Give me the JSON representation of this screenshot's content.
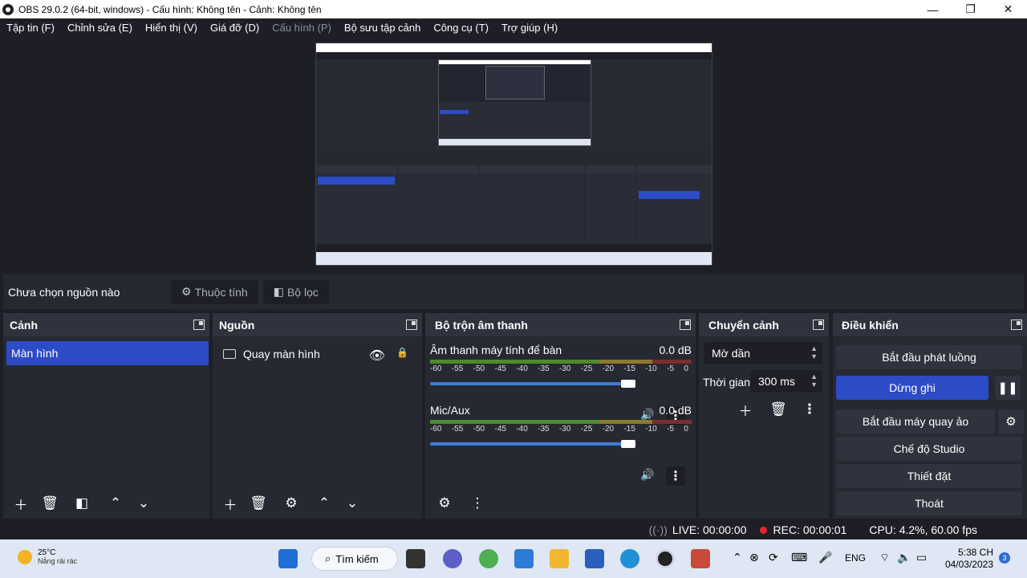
{
  "window": {
    "title": "OBS 29.0.2 (64-bit, windows) - Cấu hình: Không tên - Cảnh: Không tên",
    "minimize": "—",
    "maximize": "❐",
    "close": "✕"
  },
  "menu": {
    "file": "Tập tin (F)",
    "edit": "Chỉnh sửa (E)",
    "view": "Hiển thị (V)",
    "docks": "Giá đỡ (D)",
    "profile": "Cấu hình (P)",
    "scene_collection": "Bộ sưu tập cảnh",
    "tools": "Công cụ (T)",
    "help": "Trợ giúp (H)"
  },
  "source_toolbar": {
    "no_source": "Chưa chọn nguồn nào",
    "properties": "Thuộc tính",
    "filters": "Bộ lọc"
  },
  "scenes": {
    "title": "Cảnh",
    "items": [
      "Màn hình"
    ]
  },
  "sources": {
    "title": "Nguồn",
    "items": [
      "Quay màn hình"
    ]
  },
  "mixer": {
    "title": "Bộ trộn âm thanh",
    "ticks": [
      "-60",
      "-55",
      "-50",
      "-45",
      "-40",
      "-35",
      "-30",
      "-25",
      "-20",
      "-15",
      "-10",
      "-5",
      "0"
    ],
    "channels": [
      {
        "name": "Âm thanh máy tính để bàn",
        "level": "0.0 dB"
      },
      {
        "name": "Mic/Aux",
        "level": "0.0 dB"
      }
    ]
  },
  "transitions": {
    "title": "Chuyển cảnh",
    "selected": "Mờ dần",
    "duration_label": "Thời gian",
    "duration_value": "300 ms"
  },
  "controls": {
    "title": "Điều khiển",
    "start_streaming": "Bắt đầu phát luồng",
    "stop_recording": "Dừng ghi",
    "start_virtual_cam": "Bắt đầu máy quay ảo",
    "studio_mode": "Chế độ Studio",
    "settings": "Thiết đặt",
    "exit": "Thoát"
  },
  "status": {
    "live": "LIVE: 00:00:00",
    "rec": "REC: 00:00:01",
    "cpu": "CPU: 4.2%, 60.00 fps"
  },
  "taskbar": {
    "temperature": "25°C",
    "weather": "Nắng rải rác",
    "search": "Tìm kiếm",
    "language": "ENG",
    "time": "5:38 CH",
    "date": "04/03/2023",
    "notifications": "3"
  },
  "colors": {
    "accent": "#2c4cc6",
    "panel": "#272932",
    "background": "#1e1f26"
  }
}
